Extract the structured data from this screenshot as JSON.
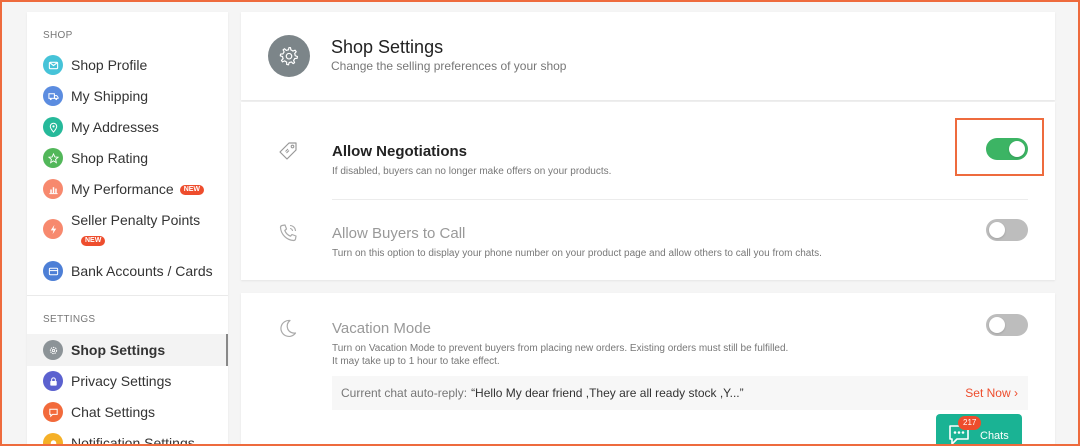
{
  "sidebar": {
    "shop_section_title": "SHOP",
    "settings_section_title": "SETTINGS",
    "shop_items": [
      {
        "label": "Shop Profile",
        "icon": "profile-icon",
        "color": "#46c3d8"
      },
      {
        "label": "My Shipping",
        "icon": "truck-icon",
        "color": "#5b8ce0"
      },
      {
        "label": "My Addresses",
        "icon": "location-icon",
        "color": "#26b99a"
      },
      {
        "label": "Shop Rating",
        "icon": "star-icon",
        "color": "#52b75a"
      },
      {
        "label": "My Performance",
        "icon": "chart-icon",
        "color": "#f7896e",
        "badge": "NEW"
      },
      {
        "label": "Seller Penalty Points",
        "icon": "lightning-icon",
        "color": "#f7896e",
        "badge": "NEW"
      },
      {
        "label": "Bank Accounts / Cards",
        "icon": "card-icon",
        "color": "#4d7fd6"
      }
    ],
    "settings_items": [
      {
        "label": "Shop Settings",
        "icon": "gear-icon",
        "color": "#8c9397",
        "active": true
      },
      {
        "label": "Privacy Settings",
        "icon": "lock-icon",
        "color": "#5b61cf"
      },
      {
        "label": "Chat Settings",
        "icon": "chat-icon",
        "color": "#f26a3b"
      },
      {
        "label": "Notification Settings",
        "icon": "bell-icon",
        "color": "#f5b027"
      }
    ]
  },
  "header": {
    "title": "Shop Settings",
    "subtitle": "Change the selling preferences of your shop"
  },
  "settings": {
    "negotiations": {
      "title": "Allow Negotiations",
      "description": "If disabled, buyers can no longer make offers on your products.",
      "enabled": true
    },
    "call": {
      "title": "Allow Buyers to Call",
      "description": "Turn on this option to display your phone number on your product page and allow others to call you from chats.",
      "enabled": false
    },
    "vacation": {
      "title": "Vacation Mode",
      "description_line1": "Turn on Vacation Mode to prevent buyers from placing new orders. Existing orders must still be fulfilled.",
      "description_line2": "It may take up to 1 hour to take effect.",
      "enabled": false,
      "reply_label": "Current chat auto-reply:",
      "reply_value": "“Hello My dear friend ,They are all ready stock ,Y...”",
      "set_now": "Set Now"
    }
  },
  "chats": {
    "label": "Chats",
    "count": "217"
  },
  "colors": {
    "accent": "#ee4d2d",
    "toggle_on": "#3cb464",
    "highlight": "#ee6b3d",
    "chat_button": "#1ab394"
  }
}
